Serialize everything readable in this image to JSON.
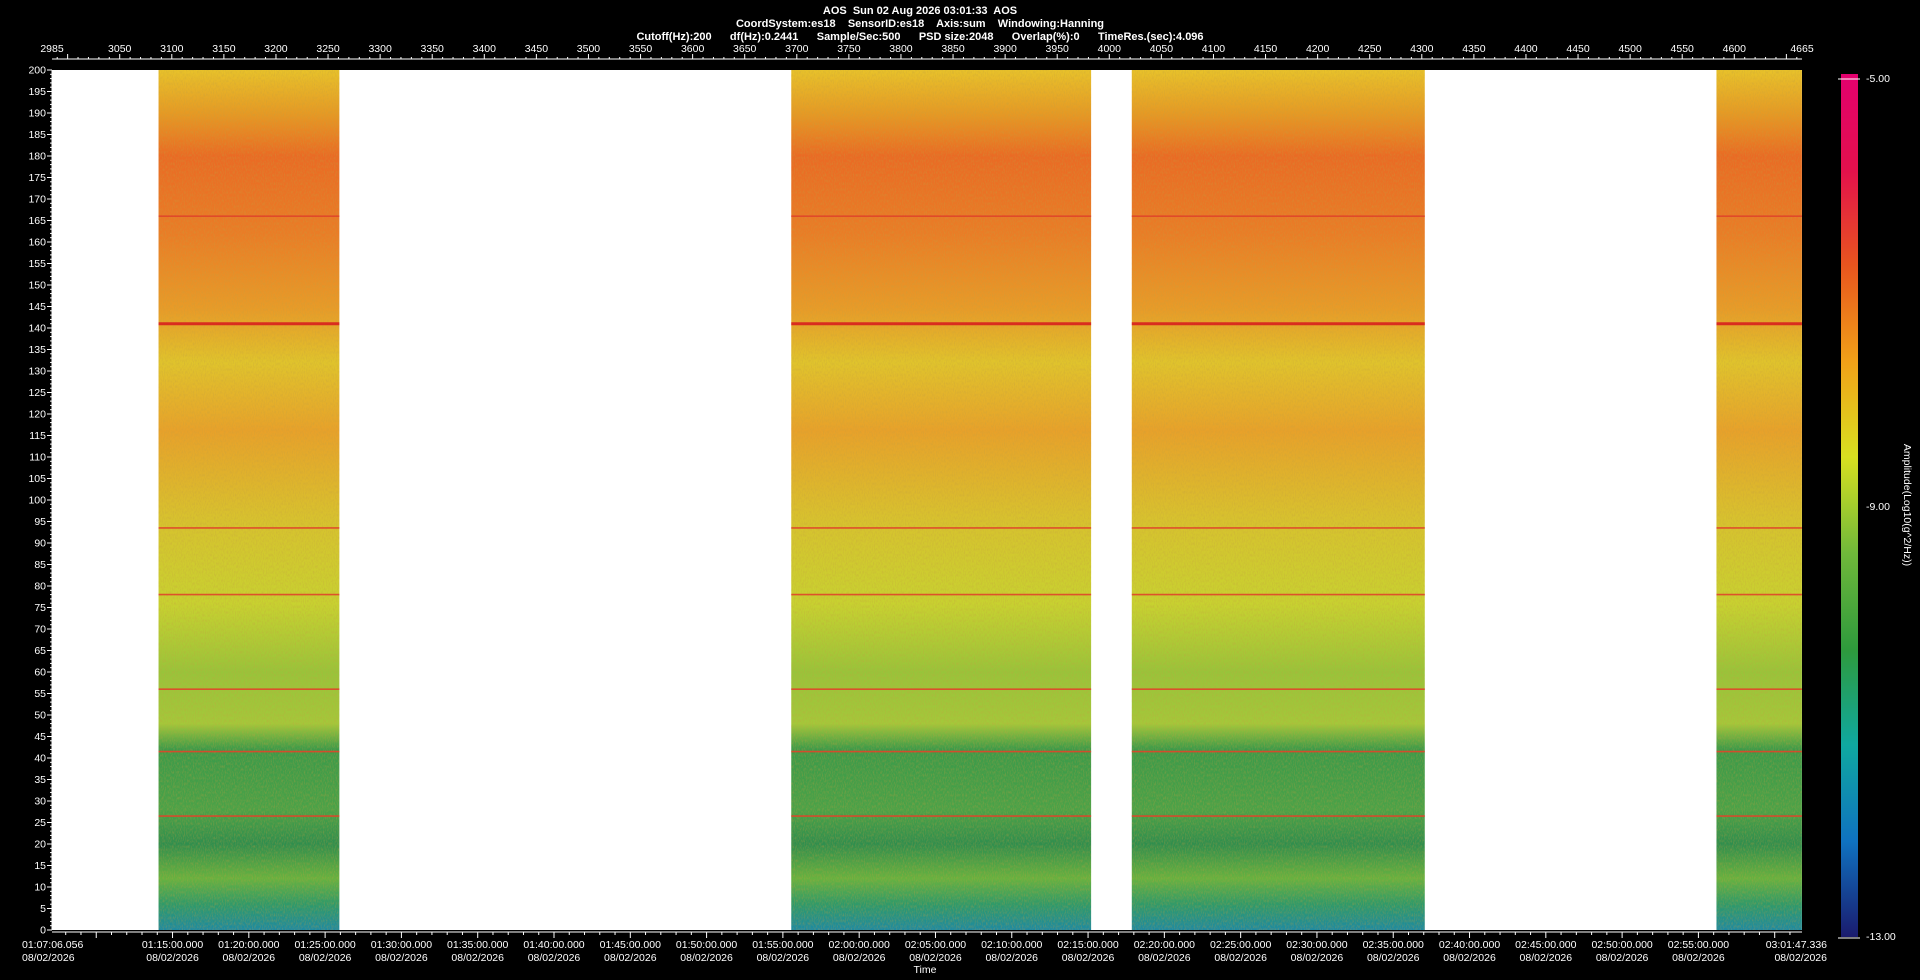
{
  "header": {
    "line1": "AOS  Sun 02 Aug 2026 03:01:33  AOS",
    "line2": "CoordSystem:es18    SensorID:es18    Axis:sum    Windowing:Hanning",
    "line3": "Cutoff(Hz):200      df(Hz):0.2441      Sample/Sec:500      PSD size:2048      Overlap(%):0      TimeRes.(sec):4.096"
  },
  "chart_data": {
    "type": "heatmap",
    "title": "AOS  Sun 02 Aug 2026 03:01:33  AOS",
    "xlabel": "Time",
    "ylabel": "",
    "colorbar_label": "Amplitude(Log10(g^2/Hz))",
    "ylim": [
      0,
      200
    ],
    "y_ticks": [
      0,
      5,
      10,
      15,
      20,
      25,
      30,
      35,
      40,
      45,
      50,
      55,
      60,
      65,
      70,
      75,
      80,
      85,
      90,
      95,
      100,
      105,
      110,
      115,
      120,
      125,
      130,
      135,
      140,
      145,
      150,
      155,
      160,
      165,
      170,
      175,
      180,
      185,
      190,
      195,
      200
    ],
    "top_axis": {
      "range": [
        2985,
        4665
      ],
      "labels": [
        "2985",
        "3050",
        "3100",
        "3150",
        "3200",
        "3250",
        "3300",
        "3350",
        "3400",
        "3450",
        "3500",
        "3550",
        "3600",
        "3650",
        "3700",
        "3750",
        "3800",
        "3850",
        "3900",
        "3950",
        "4000",
        "4050",
        "4100",
        "4150",
        "4200",
        "4250",
        "4300",
        "4350",
        "4400",
        "4450",
        "4500",
        "4550",
        "4600",
        "4665"
      ]
    },
    "time_axis": {
      "start_label": "01:07:06.056",
      "end_label": "03:01:47.336",
      "labels": [
        "01:15:00.000",
        "01:20:00.000",
        "01:25:00.000",
        "01:30:00.000",
        "01:35:00.000",
        "01:40:00.000",
        "01:45:00.000",
        "01:50:00.000",
        "01:55:00.000",
        "02:00:00.000",
        "02:05:00.000",
        "02:10:00.000",
        "02:15:00.000",
        "02:20:00.000",
        "02:25:00.000",
        "02:30:00.000",
        "02:35:00.000",
        "02:40:00.000",
        "02:45:00.000",
        "02:50:00.000",
        "02:55:00.000"
      ],
      "date_label": "08/02/2026"
    },
    "colorbar": {
      "min": -13.0,
      "max": -5.0,
      "min_label": "-13.00",
      "mid_label": "-9.00",
      "max_label": "-5.00",
      "colors": [
        "#1a1b6e",
        "#0f72c0",
        "#0fa8a0",
        "#2e9a3c",
        "#6fb83a",
        "#d8e020",
        "#f1a018",
        "#e8551e",
        "#e3104c",
        "#e3006e"
      ]
    },
    "data_segments": [
      {
        "start": "01:14:05",
        "end": "01:25:56"
      },
      {
        "start": "01:55:33",
        "end": "02:15:12"
      },
      {
        "start": "02:17:52",
        "end": "02:37:04"
      },
      {
        "start": "02:56:11",
        "end": "03:01:47"
      }
    ],
    "spectral_lines_hz": [
      141,
      93.5,
      78,
      56,
      41.5,
      166,
      26.5
    ]
  }
}
